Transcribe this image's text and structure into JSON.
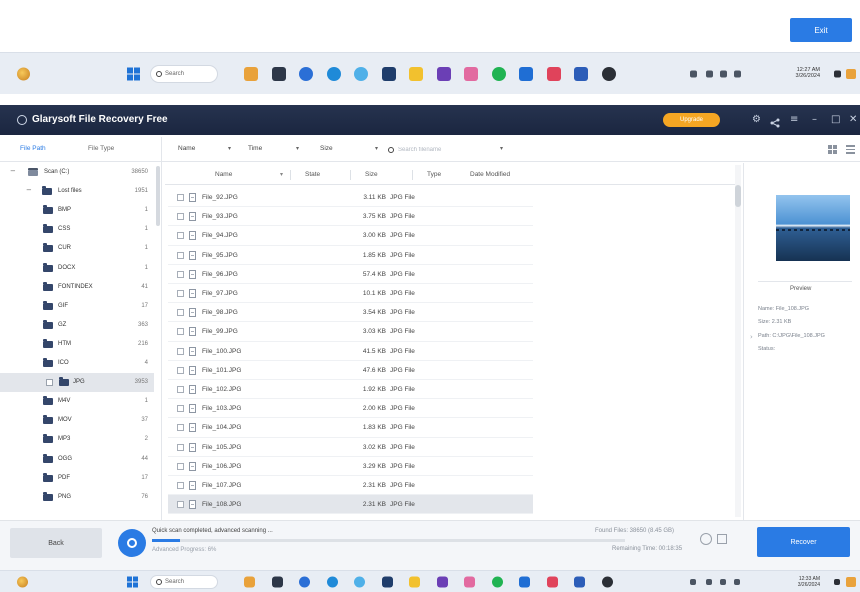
{
  "colors": {
    "accent": "#2a7be4",
    "titlebar": "#1d2a46",
    "upgrade": "#f5a623",
    "taskbar": "#e8edf4",
    "selected_row": "#e3e6eb"
  },
  "top_window": {
    "action_button": "Exit"
  },
  "taskbar": {
    "search_placeholder": "Search",
    "top_time": "12:27 AM",
    "top_date": "3/26/2024",
    "bottom_time": "12:33 AM",
    "bottom_date": "3/26/2024",
    "apps": [
      {
        "icon": "paint-icon",
        "color": "#e9a23b"
      },
      {
        "icon": "terminal-icon",
        "color": "#2d3748"
      },
      {
        "icon": "cortana-icon",
        "color": "#2b6fd6"
      },
      {
        "icon": "edge-icon",
        "color": "#1f8ad8"
      },
      {
        "icon": "copilot-icon",
        "color": "#4fb0e8"
      },
      {
        "icon": "store-icon",
        "color": "#1f3d6b"
      },
      {
        "icon": "file-explorer-icon",
        "color": "#f2c12e"
      },
      {
        "icon": "visual-studio-icon",
        "color": "#6b3fb5"
      },
      {
        "icon": "photos-icon",
        "color": "#e26aa0"
      },
      {
        "icon": "spotify-icon",
        "color": "#20b352"
      },
      {
        "icon": "mail-icon",
        "color": "#1f6ed4"
      },
      {
        "icon": "paint3d-icon",
        "color": "#e0435b"
      },
      {
        "icon": "word-icon",
        "color": "#2c5db8"
      },
      {
        "icon": "obs-icon",
        "color": "#2b2f36"
      }
    ],
    "tray": [
      {
        "icon": "chevron-up-icon",
        "color": "#4b5563"
      },
      {
        "icon": "network-icon",
        "color": "#4b5563"
      },
      {
        "icon": "volume-icon",
        "color": "#4b5563"
      },
      {
        "icon": "battery-icon",
        "color": "#4b5563"
      },
      {
        "icon": "notification-icon",
        "color": "#2b2f36"
      },
      {
        "icon": "copilot-tray-icon",
        "color": "#e9a23b"
      }
    ]
  },
  "app": {
    "title": "Glarysoft File Recovery Free",
    "upgrade_label": "Upgrade"
  },
  "toolbar": {
    "tabs": [
      {
        "label": "File Path",
        "active": true
      },
      {
        "label": "File Type",
        "active": false
      }
    ],
    "filters": [
      {
        "label": "Name"
      },
      {
        "label": "Time"
      },
      {
        "label": "Size"
      }
    ],
    "search_placeholder": "Search filename"
  },
  "tree": {
    "items": [
      {
        "label": "Scan (C:)",
        "count": "38650",
        "level": 0,
        "icon": "drive-icon"
      },
      {
        "label": "Lost files",
        "count": "1951",
        "level": 1,
        "icon": "folder-icon"
      },
      {
        "label": "BMP",
        "count": "1",
        "level": 2,
        "icon": "folder-icon"
      },
      {
        "label": "CSS",
        "count": "1",
        "level": 2,
        "icon": "folder-icon"
      },
      {
        "label": "CUR",
        "count": "1",
        "level": 2,
        "icon": "folder-icon"
      },
      {
        "label": "DOCX",
        "count": "1",
        "level": 2,
        "icon": "folder-icon"
      },
      {
        "label": "FONTINDEX",
        "count": "41",
        "level": 2,
        "icon": "folder-icon"
      },
      {
        "label": "GIF",
        "count": "17",
        "level": 2,
        "icon": "folder-icon"
      },
      {
        "label": "GZ",
        "count": "363",
        "level": 2,
        "icon": "folder-icon"
      },
      {
        "label": "HTM",
        "count": "216",
        "level": 2,
        "icon": "folder-icon"
      },
      {
        "label": "ICO",
        "count": "4",
        "level": 2,
        "icon": "folder-icon"
      },
      {
        "label": "JPG",
        "count": "3953",
        "level": 2,
        "icon": "folder-icon",
        "selected": true
      },
      {
        "label": "M4V",
        "count": "1",
        "level": 2,
        "icon": "folder-icon"
      },
      {
        "label": "MOV",
        "count": "37",
        "level": 2,
        "icon": "folder-icon"
      },
      {
        "label": "MP3",
        "count": "2",
        "level": 2,
        "icon": "folder-icon"
      },
      {
        "label": "OGG",
        "count": "44",
        "level": 2,
        "icon": "folder-icon"
      },
      {
        "label": "PDF",
        "count": "17",
        "level": 2,
        "icon": "folder-icon"
      },
      {
        "label": "PNG",
        "count": "76",
        "level": 2,
        "icon": "folder-icon"
      }
    ]
  },
  "file_list": {
    "columns": {
      "name": "Name",
      "state": "State",
      "size": "Size",
      "type": "Type",
      "date": "Date Modified"
    },
    "rows": [
      {
        "name": "File_92.JPG",
        "size": "3.11 KB",
        "type": "JPG File"
      },
      {
        "name": "File_93.JPG",
        "size": "3.75 KB",
        "type": "JPG File"
      },
      {
        "name": "File_94.JPG",
        "size": "3.00 KB",
        "type": "JPG File"
      },
      {
        "name": "File_95.JPG",
        "size": "1.85 KB",
        "type": "JPG File"
      },
      {
        "name": "File_96.JPG",
        "size": "57.4 KB",
        "type": "JPG File"
      },
      {
        "name": "File_97.JPG",
        "size": "10.1 KB",
        "type": "JPG File"
      },
      {
        "name": "File_98.JPG",
        "size": "3.54 KB",
        "type": "JPG File"
      },
      {
        "name": "File_99.JPG",
        "size": "3.03 KB",
        "type": "JPG File"
      },
      {
        "name": "File_100.JPG",
        "size": "41.5 KB",
        "type": "JPG File"
      },
      {
        "name": "File_101.JPG",
        "size": "47.6 KB",
        "type": "JPG File"
      },
      {
        "name": "File_102.JPG",
        "size": "1.92 KB",
        "type": "JPG File"
      },
      {
        "name": "File_103.JPG",
        "size": "2.00 KB",
        "type": "JPG File"
      },
      {
        "name": "File_104.JPG",
        "size": "1.83 KB",
        "type": "JPG File"
      },
      {
        "name": "File_105.JPG",
        "size": "3.02 KB",
        "type": "JPG File"
      },
      {
        "name": "File_106.JPG",
        "size": "3.29 KB",
        "type": "JPG File"
      },
      {
        "name": "File_107.JPG",
        "size": "2.31 KB",
        "type": "JPG File"
      },
      {
        "name": "File_108.JPG",
        "size": "2.31 KB",
        "type": "JPG File",
        "selected": true
      }
    ]
  },
  "preview": {
    "title": "Preview",
    "name": "Name: File_108.JPG",
    "size": "Size: 2.31 KB",
    "path": "Path: C:\\JPG\\File_108.JPG",
    "status": "Status:"
  },
  "status": {
    "back_label": "Back",
    "message": "Quick scan completed, advanced scanning ...",
    "sub_message": "Advanced Progress: 6%",
    "progress": 0.06,
    "found_files": "Found Files: 38650 (8.45 GB)",
    "remaining_time": "Remaining Time: 00:18:35",
    "recover_label": "Recover"
  }
}
